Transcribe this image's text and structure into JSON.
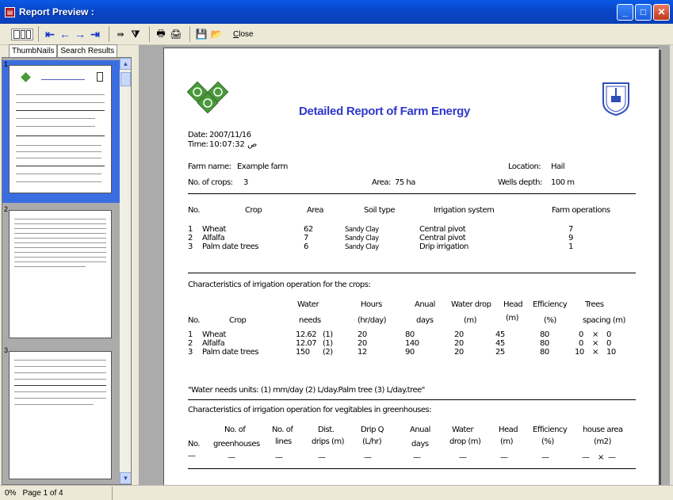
{
  "window": {
    "title": "Report Preview :",
    "app_icon": "report-preview-icon"
  },
  "toolbar": {
    "close_label": "Close",
    "close_accesskey": "C",
    "close_rest": "lose"
  },
  "tabs": [
    {
      "label": "ThumbNails"
    },
    {
      "label": "Search Results"
    }
  ],
  "thumbnails": [
    {
      "number": "1"
    },
    {
      "number": "2"
    },
    {
      "number": "3"
    }
  ],
  "status": {
    "zoom": "0%",
    "page": "Page 1 of 4"
  },
  "report": {
    "title": "Detailed Report of Farm Energy",
    "date_label": "Date:",
    "date_value": "2007/11/16",
    "time_label": "Time:",
    "time_value": "10:07:32 ص",
    "farm_name_label": "Farm name:",
    "farm_name_value": "Example farm",
    "location_label": "Location:",
    "location_value": "Hail",
    "crops_label": "No. of crops:",
    "crops_value": "3",
    "area_label": "Area:",
    "area_value": "75 ha",
    "wells_label": "Wells depth:",
    "wells_value": "100 m",
    "crop_table": {
      "headers": [
        "No.",
        "Crop",
        "Area",
        "Soil type",
        "Irrigation system",
        "Farm operations"
      ],
      "rows": [
        [
          "1",
          "Wheat",
          "62",
          "Sandy Clay",
          "Central pivot",
          "7"
        ],
        [
          "2",
          "Alfalfa",
          "7",
          "Sandy Clay",
          "Central pivot",
          "9"
        ],
        [
          "3",
          "Palm date trees",
          "6",
          "Sandy Clay",
          "Drip irrigation",
          "1"
        ]
      ]
    },
    "irrigation_heading": "Characteristics of irrigation operation for the crops:",
    "irrigation_table": {
      "header_top": [
        "Water",
        "Hours",
        "Anual",
        "Water drop",
        "Head",
        "Efficiency",
        "Trees"
      ],
      "header_bottom": [
        "No.",
        "Crop",
        "needs",
        "(hr/day)",
        "days",
        "(m)",
        "(m)",
        "(%)",
        "spacing (m)"
      ],
      "rows": [
        [
          "1",
          "Wheat",
          "12.62",
          "(1)",
          "20",
          "80",
          "20",
          "45",
          "80",
          "0",
          "×",
          "0"
        ],
        [
          "2",
          "Alfalfa",
          "12.07",
          "(1)",
          "20",
          "140",
          "20",
          "45",
          "80",
          "0",
          "×",
          "0"
        ],
        [
          "3",
          "Palm date trees",
          "150",
          "(2)",
          "12",
          "90",
          "20",
          "25",
          "80",
          "10",
          "×",
          "10"
        ]
      ]
    },
    "units_note": "\"Water needs units: (1) mm/day  (2) L/day.Palm tree  (3) L/day.tree\"",
    "greenhouse_heading": "Characteristics of irrigation operation for vegitables in greenhouses:",
    "greenhouse_table": {
      "header_top": [
        "No. of",
        "No. of",
        "Dist.",
        "Drip Q",
        "Anual",
        "Water",
        "Head",
        "Efficiency",
        "house area"
      ],
      "header_bottom": [
        "No.",
        "greenhouses",
        "lines",
        "drips (m)",
        "(L/hr)",
        "days",
        "drop (m)",
        "(m)",
        "(%)",
        "(m2)"
      ],
      "row": [
        "—",
        "—",
        "—",
        "—",
        "—",
        "—",
        "—",
        "—",
        "—",
        "—",
        "×",
        "—"
      ]
    }
  }
}
